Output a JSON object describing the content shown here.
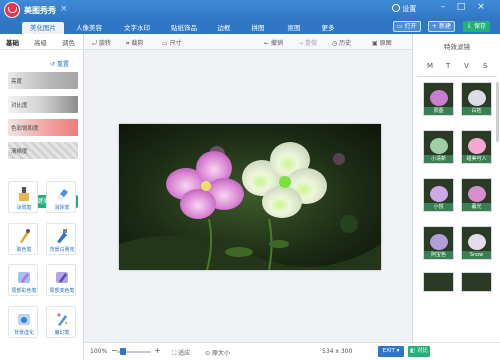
{
  "app": {
    "title": "美图秀秀",
    "close": "×"
  },
  "titlebar": {
    "settings": "设置"
  },
  "tabs": [
    {
      "label": "美化图片"
    },
    {
      "label": "人像美容"
    },
    {
      "label": "文字水印"
    },
    {
      "label": "贴纸饰品"
    },
    {
      "label": "边框"
    },
    {
      "label": "拼图"
    },
    {
      "label": "抠图"
    },
    {
      "label": "更多"
    }
  ],
  "toolbar_buttons": {
    "open": "打开",
    "new": "新建",
    "save": "保存"
  },
  "left_panel": {
    "subtabs": [
      "基础",
      "高级",
      "调色"
    ],
    "reset": "重置",
    "sliders": [
      {
        "label": "亮度",
        "color": "#b7b7b7"
      },
      {
        "label": "对比度",
        "color": "#9a9a9a"
      },
      {
        "label": "色彩饱和度",
        "color": "#f08a8a"
      },
      {
        "label": "清晰度",
        "color": "#cfcfcf"
      }
    ],
    "one_key": "一键美化",
    "tools": [
      {
        "label": "涂鸦笔",
        "icon": "doodle-pen-icon"
      },
      {
        "label": "消除笔",
        "icon": "eraser-pen-icon"
      },
      {
        "label": "取色笔",
        "icon": "color-picker-icon"
      },
      {
        "label": "背景马赛克",
        "icon": "mosaic-icon"
      },
      {
        "label": "局部彩色笔",
        "icon": "partial-color-pen-icon"
      },
      {
        "label": "局部变色笔",
        "icon": "color-change-pen-icon"
      },
      {
        "label": "背景虚化",
        "icon": "background-blur-icon"
      },
      {
        "label": "魔幻笔",
        "icon": "magic-pen-icon"
      }
    ]
  },
  "canvas_toolbar": {
    "rotate": "旋转",
    "crop": "裁剪",
    "size": "尺寸",
    "undo": "撤销",
    "redo": "重做",
    "history": "历史",
    "original": "原图"
  },
  "bottom_bar": {
    "zoom": "100%",
    "zoom_minus": "−",
    "zoom_plus": "+",
    "fit": "适应",
    "actual": "原大小",
    "dimensions": "534 x 300",
    "exit": "EXIT",
    "compare": "对比"
  },
  "right_panel": {
    "title": "特效滤镜",
    "categories": [
      "M",
      "T",
      "V",
      "S"
    ],
    "filters": [
      {
        "label": "原图",
        "tint": "#c77fcf"
      },
      {
        "label": "白拓",
        "tint": "#dcdce6"
      },
      {
        "label": "小清新",
        "tint": "#9fcfa6"
      },
      {
        "label": "甜美可人",
        "tint": "#f2a8d0"
      },
      {
        "label": "小悦",
        "tint": "#cfa9e6"
      },
      {
        "label": "暮光",
        "tint": "#d68ecf"
      },
      {
        "label": "阿宝色",
        "tint": "#b39ddb"
      },
      {
        "label": "Snow",
        "tint": "#e4dcea"
      }
    ]
  }
}
